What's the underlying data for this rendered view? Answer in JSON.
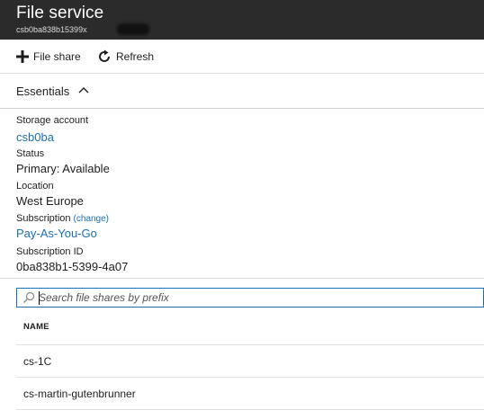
{
  "header": {
    "title": "File service",
    "subtitle": "csb0ba838b15399x"
  },
  "toolbar": {
    "add_label": "File share",
    "refresh_label": "Refresh"
  },
  "essentials": {
    "label": "Essentials"
  },
  "properties": {
    "storage_account_label": "Storage account",
    "storage_account_value": "csb0ba",
    "status_label": "Status",
    "status_value": "Primary: Available",
    "location_label": "Location",
    "location_value": "West Europe",
    "subscription_label": "Subscription",
    "subscription_change": "(change)",
    "subscription_value": "Pay-As-You-Go",
    "subscription_id_label": "Subscription ID",
    "subscription_id_value": "0ba838b1-5399-4a07"
  },
  "search": {
    "placeholder": "Search file shares by prefix",
    "value": ""
  },
  "table": {
    "column_name": "NAME",
    "rows": [
      {
        "name": "cs-1C"
      },
      {
        "name": "cs-martin-gutenbrunner"
      }
    ]
  },
  "colors": {
    "header_bg": "#2b2b2b",
    "link": "#1a6fb5",
    "search_border": "#1a6fb5"
  }
}
